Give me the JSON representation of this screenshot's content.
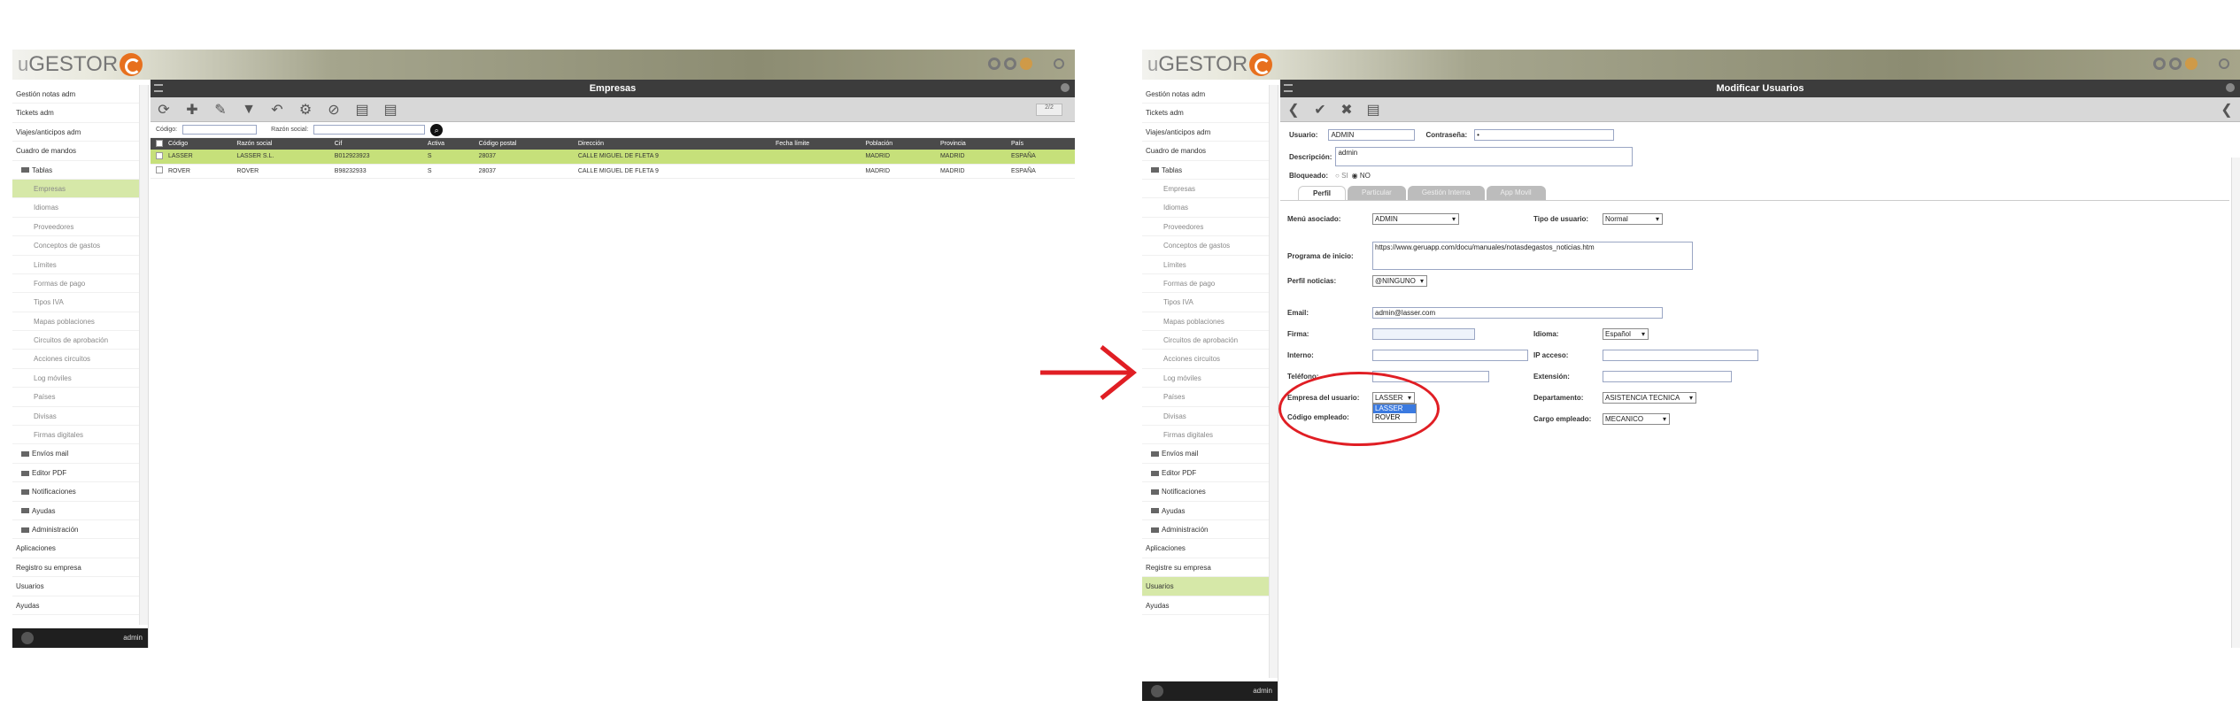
{
  "left": {
    "logo": {
      "u": "u",
      "rest": "GESTOR"
    },
    "title": "Empresas",
    "sidebar": [
      {
        "label": "Gestión notas adm",
        "kind": "root"
      },
      {
        "label": "Tickets adm",
        "kind": "root"
      },
      {
        "label": "Viajes/anticipos adm",
        "kind": "root"
      },
      {
        "label": "Cuadro de mandos",
        "kind": "root"
      },
      {
        "label": "Tablas",
        "kind": "folder"
      },
      {
        "label": "Empresas",
        "kind": "sub",
        "active": true
      },
      {
        "label": "Idiomas",
        "kind": "sub"
      },
      {
        "label": "Proveedores",
        "kind": "sub"
      },
      {
        "label": "Conceptos de gastos",
        "kind": "sub"
      },
      {
        "label": "Límites",
        "kind": "sub"
      },
      {
        "label": "Formas de pago",
        "kind": "sub"
      },
      {
        "label": "Tipos IVA",
        "kind": "sub"
      },
      {
        "label": "Mapas poblaciones",
        "kind": "sub"
      },
      {
        "label": "Circuitos de aprobación",
        "kind": "sub"
      },
      {
        "label": "Acciones circuitos",
        "kind": "sub"
      },
      {
        "label": "Log móviles",
        "kind": "sub"
      },
      {
        "label": "Países",
        "kind": "sub"
      },
      {
        "label": "Divisas",
        "kind": "sub"
      },
      {
        "label": "Firmas digitales",
        "kind": "sub"
      },
      {
        "label": "Envíos mail",
        "kind": "folder"
      },
      {
        "label": "Editor PDF",
        "kind": "folder"
      },
      {
        "label": "Notificaciones",
        "kind": "folder"
      },
      {
        "label": "Ayudas",
        "kind": "folder"
      },
      {
        "label": "Administración",
        "kind": "folder"
      },
      {
        "label": "Aplicaciones",
        "kind": "root"
      },
      {
        "label": "Registro su empresa",
        "kind": "root"
      },
      {
        "label": "Usuarios",
        "kind": "root"
      },
      {
        "label": "Ayudas",
        "kind": "root"
      }
    ],
    "user": "admin",
    "filter": {
      "codigo_label": "Código:",
      "razon_label": "Razón social:"
    },
    "columns": [
      "Código",
      "Razón social",
      "Cif",
      "Activa",
      "Código postal",
      "Dirección",
      "Fecha límite",
      "Población",
      "Provincia",
      "País"
    ],
    "rows": [
      {
        "cells": [
          "LASSER",
          "LASSER S.L.",
          "B012923923",
          "S",
          "28037",
          "CALLE MIGUEL DE FLETA 9",
          "",
          "MADRID",
          "MADRID",
          "ESPAÑA"
        ],
        "selected": true
      },
      {
        "cells": [
          "ROVER",
          "ROVER",
          "B98232933",
          "S",
          "28037",
          "CALLE MIGUEL DE FLETA 9",
          "",
          "MADRID",
          "MADRID",
          "ESPAÑA"
        ],
        "selected": false
      }
    ],
    "pager": "2/2"
  },
  "right": {
    "logo": {
      "u": "u",
      "rest": "GESTOR"
    },
    "title": "Modificar Usuarios",
    "sidebar": [
      {
        "label": "Gestión notas adm",
        "kind": "root"
      },
      {
        "label": "Tickets adm",
        "kind": "root"
      },
      {
        "label": "Viajes/anticipos adm",
        "kind": "root"
      },
      {
        "label": "Cuadro de mandos",
        "kind": "root"
      },
      {
        "label": "Tablas",
        "kind": "folder"
      },
      {
        "label": "Empresas",
        "kind": "sub"
      },
      {
        "label": "Idiomas",
        "kind": "sub"
      },
      {
        "label": "Proveedores",
        "kind": "sub"
      },
      {
        "label": "Conceptos de gastos",
        "kind": "sub"
      },
      {
        "label": "Límites",
        "kind": "sub"
      },
      {
        "label": "Formas de pago",
        "kind": "sub"
      },
      {
        "label": "Tipos IVA",
        "kind": "sub"
      },
      {
        "label": "Mapas poblaciones",
        "kind": "sub"
      },
      {
        "label": "Circuitos de aprobación",
        "kind": "sub"
      },
      {
        "label": "Acciones circuitos",
        "kind": "sub"
      },
      {
        "label": "Log móviles",
        "kind": "sub"
      },
      {
        "label": "Países",
        "kind": "sub"
      },
      {
        "label": "Divisas",
        "kind": "sub"
      },
      {
        "label": "Firmas digitales",
        "kind": "sub"
      },
      {
        "label": "Envíos mail",
        "kind": "folder"
      },
      {
        "label": "Editor PDF",
        "kind": "folder"
      },
      {
        "label": "Notificaciones",
        "kind": "folder"
      },
      {
        "label": "Ayudas",
        "kind": "folder"
      },
      {
        "label": "Administración",
        "kind": "folder"
      },
      {
        "label": "Aplicaciones",
        "kind": "root"
      },
      {
        "label": "Registre su empresa",
        "kind": "root"
      },
      {
        "label": "Usuarios",
        "kind": "root",
        "active": true
      },
      {
        "label": "Ayudas",
        "kind": "root"
      }
    ],
    "user": "admin",
    "form": {
      "usuario_label": "Usuario:",
      "usuario_value": "ADMIN",
      "contrasena_label": "Contraseña:",
      "contrasena_value": "•",
      "descripcion_label": "Descripción:",
      "descripcion_value": "admin",
      "bloqueado_label": "Bloqueado:",
      "bloqueado_si": "SI",
      "bloqueado_no": "NO",
      "tabs": [
        "Perfil",
        "Particular",
        "Gestión Interna",
        "App Movil"
      ],
      "menu_label": "Menú asociado:",
      "menu_value": "ADMIN",
      "tipo_label": "Tipo de usuario:",
      "tipo_value": "Normal",
      "programa_label": "Programa de inicio:",
      "programa_value": "https://www.geruapp.com/docu/manuales/notasdegastos_noticias.htm",
      "perfil_label": "Perfil noticias:",
      "perfil_value": "@NINGUNO",
      "email_label": "Email:",
      "email_value": "admin@lasser.com",
      "firma_label": "Firma:",
      "idioma_label": "Idioma:",
      "idioma_value": "Español",
      "interno_label": "Interno:",
      "ip_label": "IP acceso:",
      "telefono_label": "Teléfono:",
      "extension_label": "Extensión:",
      "empresa_label": "Empresa del usuario:",
      "empresa_value": "LASSER",
      "empresa_options": [
        "LASSER",
        "ROVER"
      ],
      "departamento_label": "Departamento:",
      "departamento_value": "ASISTENCIA TECNICA",
      "codigo_label": "Código empleado:",
      "cargo_label": "Cargo empleado:",
      "cargo_value": "MECANICO"
    }
  },
  "colors": {
    "accent": "#e7701e",
    "selection": "#c6e07a",
    "highlight": "#e01e24"
  }
}
